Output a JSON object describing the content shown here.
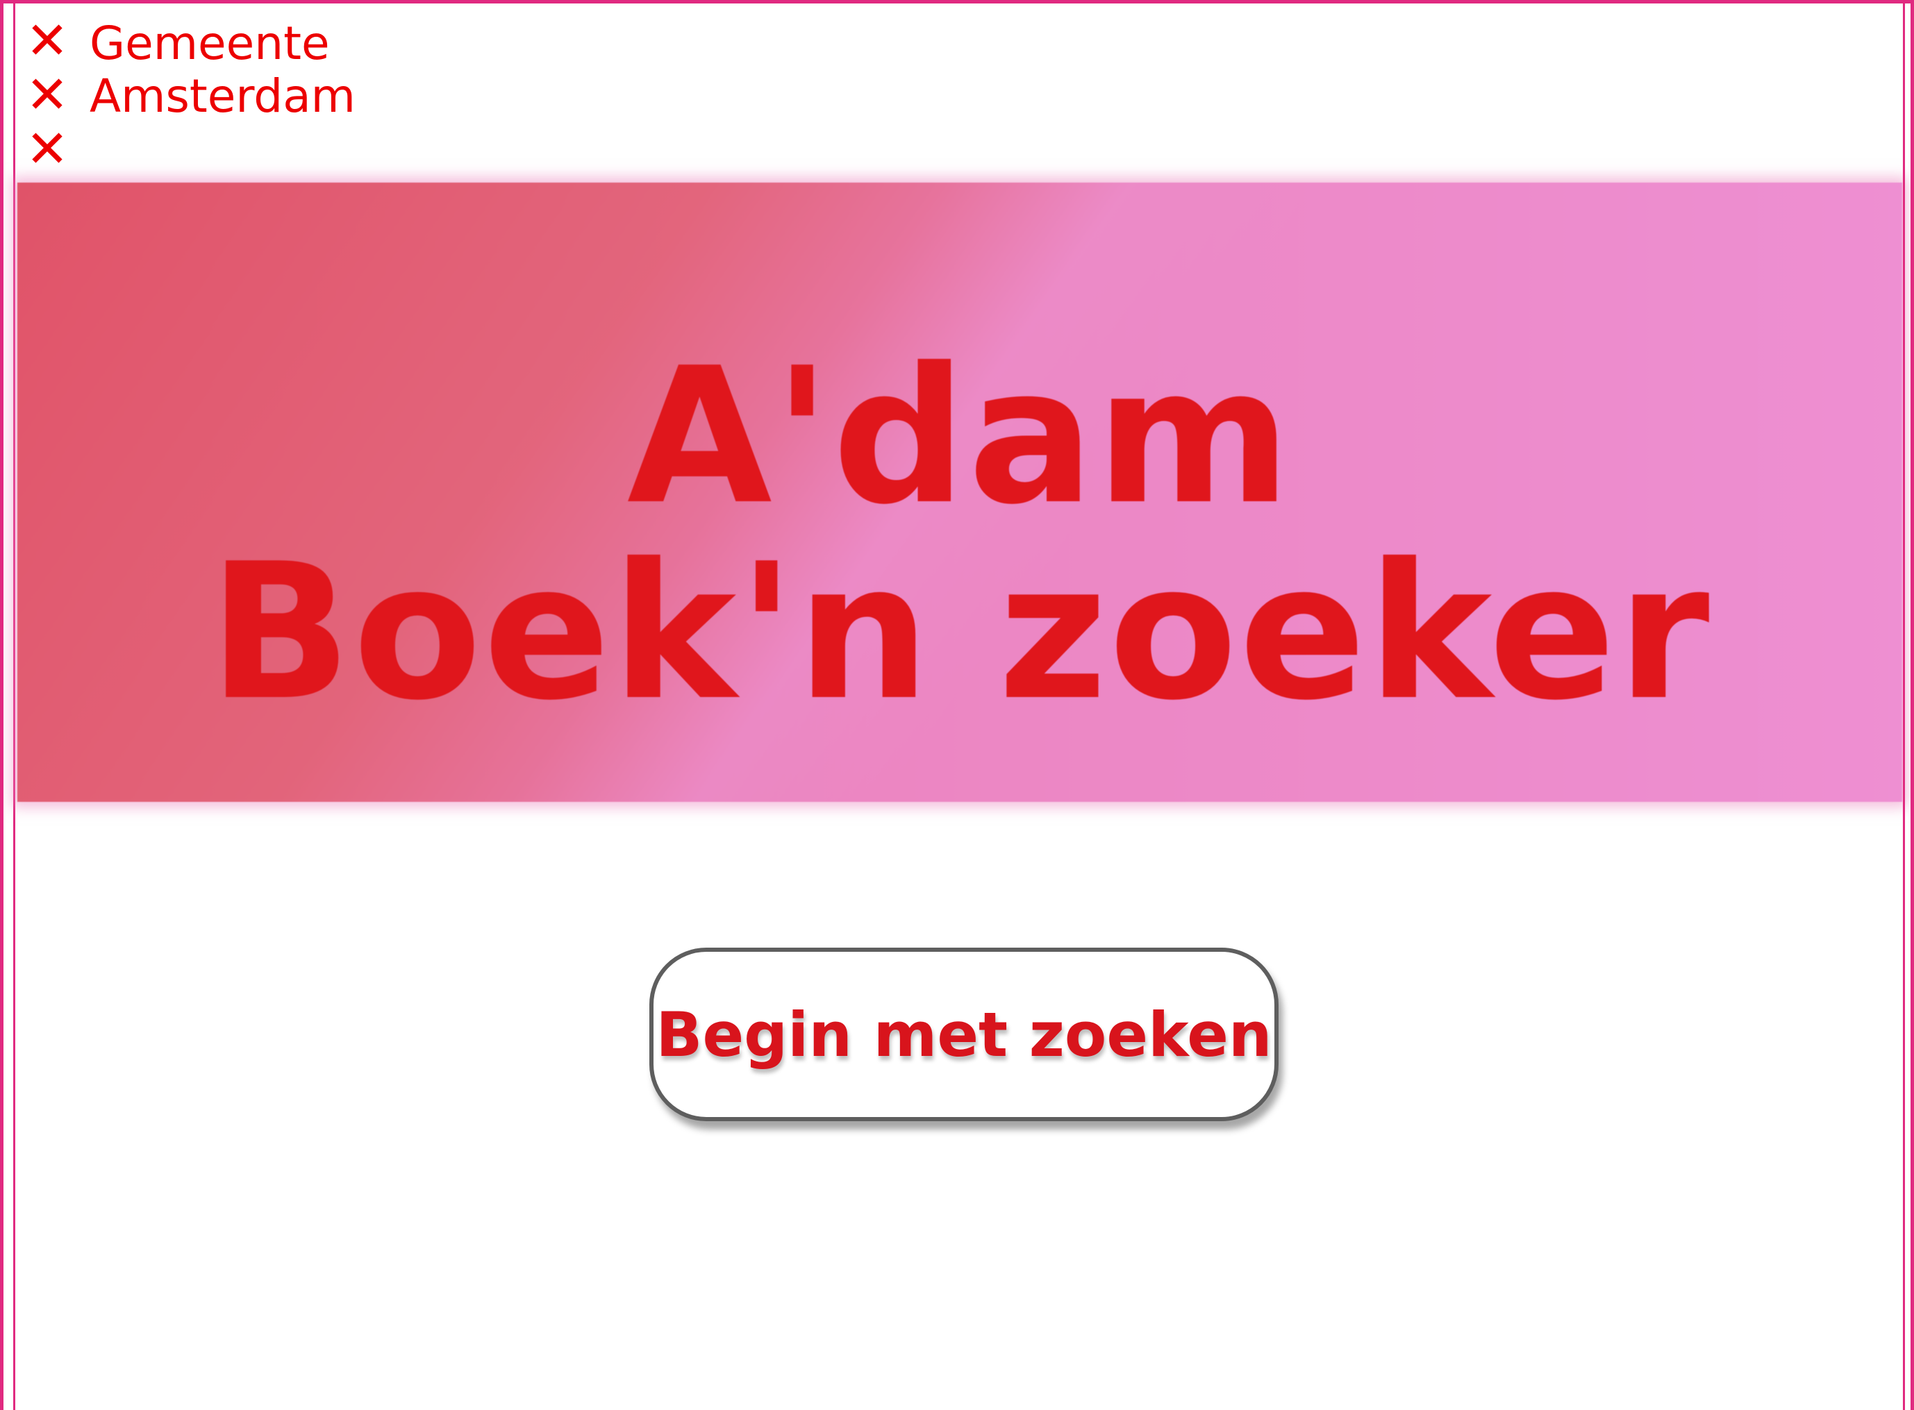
{
  "logo": {
    "crosses": [
      "✕",
      "✕",
      "✕"
    ],
    "line1": "Gemeente",
    "line2": "Amsterdam",
    "color": "#ec0000"
  },
  "hero": {
    "title_line1": "A'dam",
    "title_line2": "Boek'n zoeker",
    "title_color": "#e0161c"
  },
  "cta": {
    "label": "Begin met zoeken"
  },
  "colors": {
    "frame_border": "#e02a80",
    "hero_pink": "#ee8fd2",
    "hero_red": "#e05064"
  }
}
